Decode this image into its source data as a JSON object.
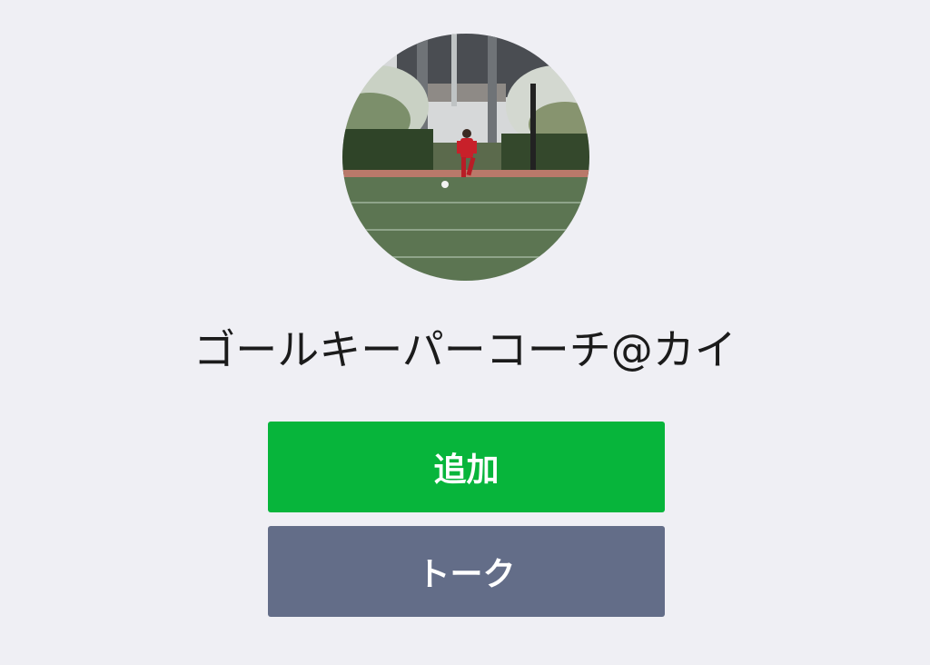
{
  "profile": {
    "display_name": "ゴールキーパーコーチ@カイ",
    "avatar_description_icon": "soccer-player-photo"
  },
  "actions": {
    "add_label": "追加",
    "talk_label": "トーク"
  },
  "colors": {
    "background": "#efeff4",
    "add_button": "#07b53b",
    "talk_button": "#636d88",
    "name_text": "#1b1b1b"
  }
}
